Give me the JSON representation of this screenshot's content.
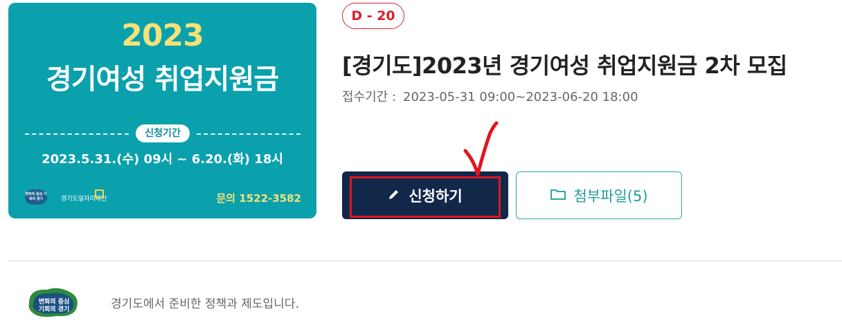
{
  "banner": {
    "year": "2023",
    "title": "경기여성 취업지원금",
    "period_label": "신청기간",
    "period_text": "2023.5.31.(수) 09시 ~ 6.20.(화) 18시",
    "logo_text_1": "변화의 중심 기회의 경기",
    "logo_text_2": "경기도일자리재단",
    "contact": "문의 1522-3582"
  },
  "dday": "D - 20",
  "title": "[경기도]2023년 경기여성 취업지원금 2차 모집",
  "period": {
    "label": "접수기간 :",
    "value": "2023-05-31 09:00~2023-06-20 18:00"
  },
  "buttons": {
    "apply_label": "신청하기",
    "files_label": "첨부파일(5)"
  },
  "org": {
    "logo_line1": "변화의 중심",
    "logo_line2": "기회의 경기",
    "description": "경기도에서 준비한 정책과 제도입니다."
  },
  "icons": {
    "apply": "pencil-icon",
    "files": "folder-icon"
  },
  "colors": {
    "banner_bg": "#0aa1ad",
    "banner_accent": "#f6e27a",
    "dday": "#d9212b",
    "apply_bg": "#12284a",
    "highlight": "#e0161f",
    "files_border": "#2ba6a1"
  }
}
